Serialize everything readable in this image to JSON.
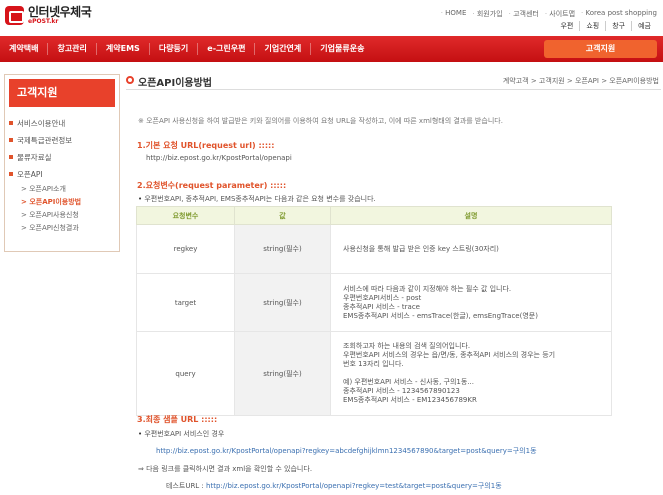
{
  "header": {
    "logo_ko": "인터넷우체국",
    "logo_en": "ePOST.kr",
    "util_top": [
      "HOME",
      "회원가입",
      "고객센터",
      "사이트맵",
      "Korea post shopping"
    ],
    "util_bottom": [
      "우편",
      "쇼핑",
      "창구",
      "예금"
    ]
  },
  "nav": {
    "items": [
      "계약택배",
      "창고관리",
      "계약EMS",
      "다량등기",
      "e-그린우편",
      "기업간연계",
      "기업물류운송"
    ],
    "active": "고객지원"
  },
  "sidebar": {
    "title": "고객지원",
    "items": [
      "서비스이용안내",
      "국제특급관련정보",
      "물류자료실",
      "오픈API"
    ],
    "subitems": [
      "오픈API소개",
      "오픈API이용방법",
      "오픈API사용신청",
      "오픈API신청결과"
    ],
    "active_sub": "오픈API이용방법"
  },
  "main": {
    "title": "오픈API이용방법",
    "breadcrumb": "계약고객 > 고객지원 > 오픈API > 오픈API이용방법",
    "intro": "※ 오픈API 사용신청을 하여 발급받은 키와 질의어를 이용하여 요청 URL을 작성하고, 이에 따른 xml형태의 결과를 받습니다.",
    "sec1_title": "1.기본 요청 URL(request url) :::::",
    "sec1_url": "http://biz.epost.go.kr/KpostPortal/openapi",
    "sec2_title": "2.요청변수(request parameter) :::::",
    "sec2_note": "우편번호API, 종추적API, EMS종추적API는 다음과 같은 요청 변수를 갖습니다.",
    "table_headers": [
      "요청변수",
      "값",
      "설명"
    ],
    "rows": [
      {
        "name": "regkey",
        "value": "string(필수)",
        "desc": [
          "사용신청을 통해 발급 받은 인증 key 스트링(30자리)"
        ]
      },
      {
        "name": "target",
        "value": "string(필수)",
        "desc": [
          "서비스에 따라 다음과 같이 지정해야 하는 필수 값 입니다.",
          "우편번호API서비스 - post",
          "종추적API 서비스 - trace",
          "EMS종추적API 서비스 - emsTrace(한글), emsEngTrace(영문)"
        ]
      },
      {
        "name": "query",
        "value": "string(필수)",
        "desc": [
          "조회하고자 하는 내용의 검색 질의어입니다.",
          "우편번호API 서비스의 경우는 읍/면/동, 종추적API 서비스의 경우는 등기",
          "번호 13자리 입니다.",
          "",
          "예) 우편번호API 서비스 - 신사동, 구의1동...",
          "종추적API 서비스 - 1234567890123",
          "EMS종추적API 서비스 - EM123456789KR"
        ]
      }
    ],
    "sec3_title": "3.최종 샘플 URL :::::",
    "sec3_case": "우편번호API 서비스인 경우",
    "sec3_url": "http://biz.epost.go.kr/KpostPortal/openapi?regkey=abcdefghijklmn1234567890&target=post&query=구의1동",
    "sec3_note": "다음 링크를 클릭하시면 결과 xml을 확인할 수 있습니다.",
    "test_label": "테스트URL :",
    "test_url": "http://biz.epost.go.kr/KpostPortal/openapi?regkey=test&target=post&query=구의1동"
  },
  "colors": {
    "brand_red": "#d7141a",
    "accent_orange": "#e0532b",
    "table_header_green": "#7f9a2e",
    "link_blue": "#3a6fb0"
  }
}
